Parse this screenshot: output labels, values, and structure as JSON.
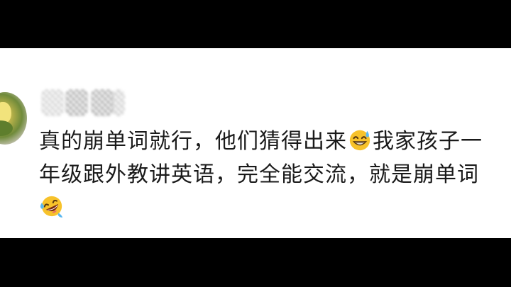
{
  "comment": {
    "text_part1": "真的崩单词就行，他们猜得出来",
    "emoji1": "grinning-sweat-emoji",
    "text_part2": "我家孩子一年级跟外教讲英语，完全能交流，就是崩单词",
    "emoji2": "rolling-on-floor-laughing-emoji"
  },
  "colors": {
    "background": "#000000",
    "card": "#ffffff",
    "text": "#1a1a1a",
    "emoji_yellow": "#f7c22b"
  }
}
